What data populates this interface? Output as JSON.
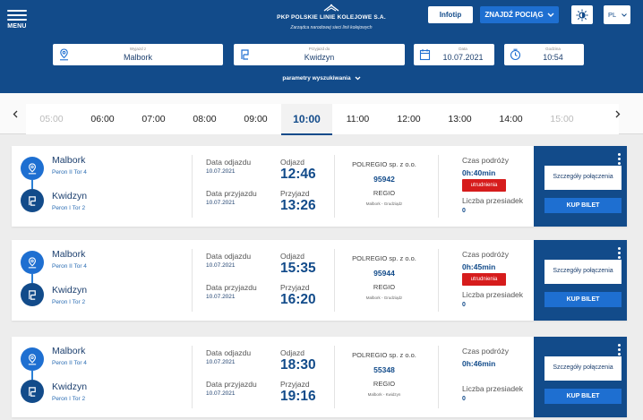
{
  "header": {
    "menu_label": "MENU",
    "logo_title": "PKP POLSKIE LINIE KOLEJOWE S.A.",
    "logo_subtitle": "Zarządca narodowej sieci linii kolejowych",
    "infotip_label": "Infotip",
    "find_label": "ZNAJDŹ POCIĄG",
    "language": "PL"
  },
  "search": {
    "from_label": "Wyjazd z",
    "from_value": "Malbork",
    "to_label": "Przyjazd do",
    "to_value": "Kwidzyn",
    "date_label": "Data",
    "date_value": "10.07.2021",
    "time_label": "Godzina",
    "time_value": "10:54",
    "params_label": "parametry wyszukiwania"
  },
  "times": [
    "05:00",
    "06:00",
    "07:00",
    "08:00",
    "09:00",
    "10:00",
    "11:00",
    "12:00",
    "13:00",
    "14:00",
    "15:00"
  ],
  "selected_time": "10:00",
  "labels": {
    "dep_date": "Data odjazdu",
    "arr_date": "Data przyjazdu",
    "dep": "Odjazd",
    "arr": "Przyjazd",
    "duration": "Czas podróży",
    "changes": "Liczba przesiadek",
    "details": "Szczegóły połączenia",
    "buy": "KUP BILET",
    "obstacle": "utrudnienia"
  },
  "connections": [
    {
      "from": "Malbork",
      "from_platform": "Peron II Tor 4",
      "to": "Kwidzyn",
      "to_platform": "Peron I Tor 2",
      "dep_date": "10.07.2021",
      "arr_date": "10.07.2021",
      "dep_time": "12:46",
      "arr_time": "13:26",
      "carrier": "POLREGIO sp. z o.o.",
      "train_no": "95942",
      "category": "REGIO",
      "route": "Malbork - Grudziądz",
      "duration": "0h:40min",
      "obstacle": true,
      "changes": "0"
    },
    {
      "from": "Malbork",
      "from_platform": "Peron II Tor 4",
      "to": "Kwidzyn",
      "to_platform": "Peron I Tor 2",
      "dep_date": "10.07.2021",
      "arr_date": "10.07.2021",
      "dep_time": "15:35",
      "arr_time": "16:20",
      "carrier": "POLREGIO sp. z o.o.",
      "train_no": "95944",
      "category": "REGIO",
      "route": "Malbork - Grudziądz",
      "duration": "0h:45min",
      "obstacle": true,
      "changes": "0"
    },
    {
      "from": "Malbork",
      "from_platform": "Peron II Tor 4",
      "to": "Kwidzyn",
      "to_platform": "Peron I Tor 2",
      "dep_date": "10.07.2021",
      "arr_date": "10.07.2021",
      "dep_time": "18:30",
      "arr_time": "19:16",
      "carrier": "POLREGIO sp. z o.o.",
      "train_no": "55348",
      "category": "REGIO",
      "route": "Malbork - Kwidzyn",
      "duration": "0h:46min",
      "obstacle": false,
      "changes": "0"
    }
  ]
}
